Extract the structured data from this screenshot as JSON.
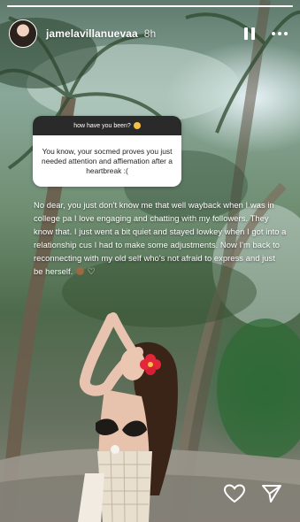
{
  "story": {
    "progress": 1.0,
    "username": "jamelavillanuevaa",
    "time_ago": "8h"
  },
  "question_sticker": {
    "prompt": "how have you been?",
    "answer": "You know, your socmed proves you just needed attention and affiemation after a heartbreak :("
  },
  "reply": {
    "text": "No dear, you just don't know me that well wayback when I was in college pa I love engaging and chatting with my followers. They know that. I just went a bit quiet and stayed lowkey when I got into a relationship cus I had to make some adjustments. Now I'm back to reconnecting with my old self who's not afraid to express and just be herself."
  },
  "icons": {
    "pause": "pause-icon",
    "more": "more-dots-icon",
    "like": "heart-icon",
    "share": "send-icon"
  }
}
